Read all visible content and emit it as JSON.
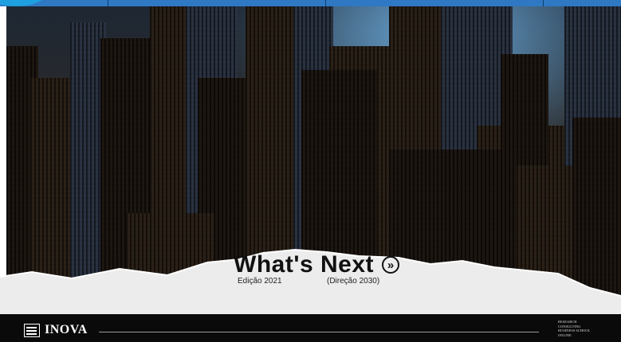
{
  "hero": {
    "title": "What's Next",
    "next_icon_glyph": "»",
    "edition_label": "Edição 2021",
    "direction_label": "(Direção 2030)",
    "image": "city-skyline-night-photo"
  },
  "footer": {
    "brand": "INOVA",
    "menu_items": [
      "RESEARCH",
      "CONSULTING",
      "BUSINESS SCHOOL",
      "ONLINE"
    ]
  },
  "colors": {
    "top_bar": "#2f78c4",
    "footer_bg": "#0a0a0a",
    "paper": "#ececec"
  }
}
